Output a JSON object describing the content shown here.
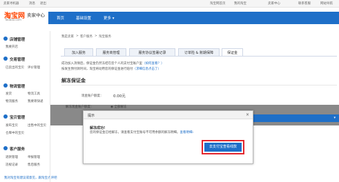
{
  "topbar": {
    "user": "卖家寻机器",
    "msg": "消息",
    "logout": "退出",
    "home": "淘宝网首页",
    "my_taobao": "我的淘宝",
    "seller_center": "卖家中心",
    "service": "联系客服",
    "site_nav": "网站导航"
  },
  "header": {
    "brand": "淘宝网",
    "brand_sub": "Taobao.com",
    "title": "卖家中心"
  },
  "nav": {
    "items": [
      "首页",
      "基础设置",
      "更多"
    ]
  },
  "sidebar": {
    "sections": [
      {
        "title": "店铺管理",
        "items": [
          "我要开店"
        ]
      },
      {
        "title": "交易管理",
        "items": [
          "已卖出的宝贝",
          "评价管理"
        ]
      },
      {
        "title": "物流管理",
        "items": [
          "发货",
          "物流工具",
          "物流服务",
          "我要寄快递"
        ]
      },
      {
        "title": "宝贝管理",
        "items": [
          "发布宝贝",
          "出售中的宝贝",
          "仓库中的宝贝"
        ]
      },
      {
        "title": "客户服务",
        "items": [
          "退款管理",
          "举报管理",
          "违规记录",
          "售后服务"
        ]
      }
    ],
    "footer": "我对淘宝有建议或意见，跟淘宝点评吧"
  },
  "breadcrumb": {
    "items": [
      "我是卖家",
      "客户服务",
      "淘宝服务"
    ]
  },
  "tabs": {
    "items": [
      "加入服务",
      "服务商管理",
      "服务协议签署记录",
      "订单险 & 账期保障",
      "保证金"
    ]
  },
  "notice": {
    "line1_a": "成功加入消保后，保证金仍然冻结在您个人的支付宝账户里",
    "line1_link": "（如何查看？）",
    "line2_a": "按发生预付款时间，淘宝将动用您的保证金进行赔付",
    "line2_link": "（求细信息点击了）"
  },
  "section": {
    "title": "解冻保证金",
    "balance_label": "现金账户额度：",
    "balance_value": "0.00元",
    "unfreeze_label": "解冻现金账户额度：",
    "unfreeze_option": "全部解冻"
  },
  "dialog": {
    "title": "提示",
    "close": "×",
    "msg_title": "解冻成功!",
    "msg_body": "您的保证金已经解冻，请查看支付宝账号不可用余额的解冻明细。",
    "msg_link": "查看明细",
    "button": "去支付宝查看线款"
  },
  "colors": {
    "brand_blue": "#1e6fc8",
    "accent_red": "#e4242b",
    "taobao_orange": "#ff4400"
  }
}
